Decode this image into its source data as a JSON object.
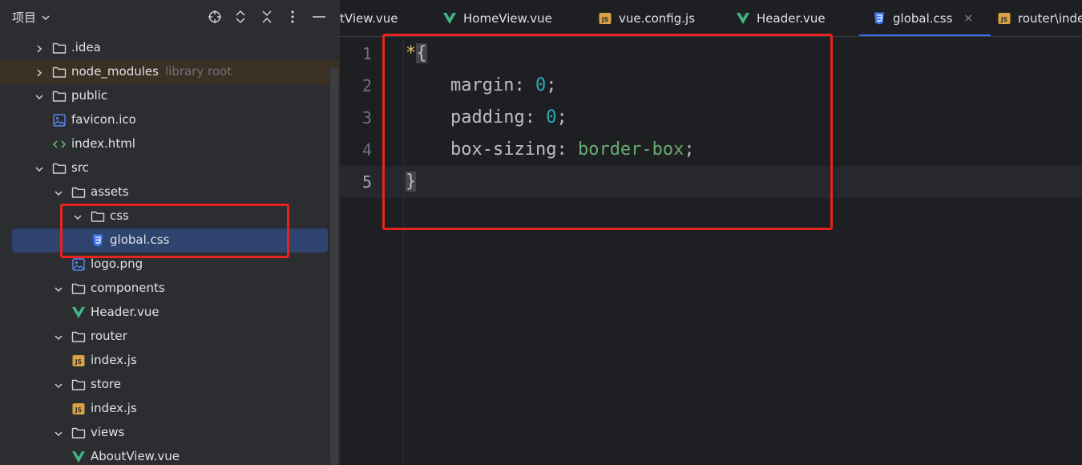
{
  "project_panel": {
    "title": "项目",
    "tree": [
      {
        "label": ".idea",
        "type": "folder",
        "expanded": false
      },
      {
        "label": "node_modules",
        "hint": "library root",
        "type": "folder",
        "expanded": false
      },
      {
        "label": "public",
        "type": "folder",
        "expanded": true
      },
      {
        "label": "favicon.ico",
        "type": "image-file"
      },
      {
        "label": "index.html",
        "type": "html-file"
      },
      {
        "label": "src",
        "type": "folder",
        "expanded": true
      },
      {
        "label": "assets",
        "type": "folder",
        "expanded": true
      },
      {
        "label": "css",
        "type": "folder",
        "expanded": true
      },
      {
        "label": "global.css",
        "type": "css-file",
        "selected": true
      },
      {
        "label": "logo.png",
        "type": "image-file"
      },
      {
        "label": "components",
        "type": "folder",
        "expanded": true
      },
      {
        "label": "Header.vue",
        "type": "vue-file"
      },
      {
        "label": "router",
        "type": "folder",
        "expanded": true
      },
      {
        "label": "index.js",
        "type": "js-file"
      },
      {
        "label": "store",
        "type": "folder",
        "expanded": true
      },
      {
        "label": "index.js",
        "type": "js-file"
      },
      {
        "label": "views",
        "type": "folder",
        "expanded": true
      },
      {
        "label": "AboutView.vue",
        "type": "vue-file"
      }
    ]
  },
  "tabs": [
    {
      "label": "tView.vue",
      "type": "vue-file"
    },
    {
      "label": "HomeView.vue",
      "type": "vue-file"
    },
    {
      "label": "vue.config.js",
      "type": "js-file"
    },
    {
      "label": "Header.vue",
      "type": "vue-file"
    },
    {
      "label": "global.css",
      "type": "css-file",
      "active": true,
      "close": "×"
    },
    {
      "label": "router\\inde",
      "type": "js-file"
    }
  ],
  "editor": {
    "line_numbers": [
      "1",
      "2",
      "3",
      "4",
      "5"
    ],
    "current_line": "5",
    "code": {
      "selector": "*",
      "open_brace": "{",
      "close_brace": "}",
      "decls": [
        {
          "prop": "margin",
          "value": "0",
          "kind": "number"
        },
        {
          "prop": "padding",
          "value": "0",
          "kind": "number"
        },
        {
          "prop": "box-sizing",
          "value": "border-box",
          "kind": "keyword"
        }
      ],
      "colon": ": ",
      "semicolon": ";"
    }
  },
  "colors": {
    "accent": "#3574f0",
    "annotation": "#e8231f",
    "folder_icon": "#ced0d6",
    "vue": "#41b883",
    "js": "#d9a343",
    "css": "#3f77f5"
  },
  "icons": {
    "title_dropdown": "chevron-down-icon",
    "locate": "crosshair-icon",
    "expand_all": "expand-all-icon",
    "collapse_all": "collapse-all-icon",
    "options": "more-vertical-icon",
    "hide": "minimize-icon"
  }
}
